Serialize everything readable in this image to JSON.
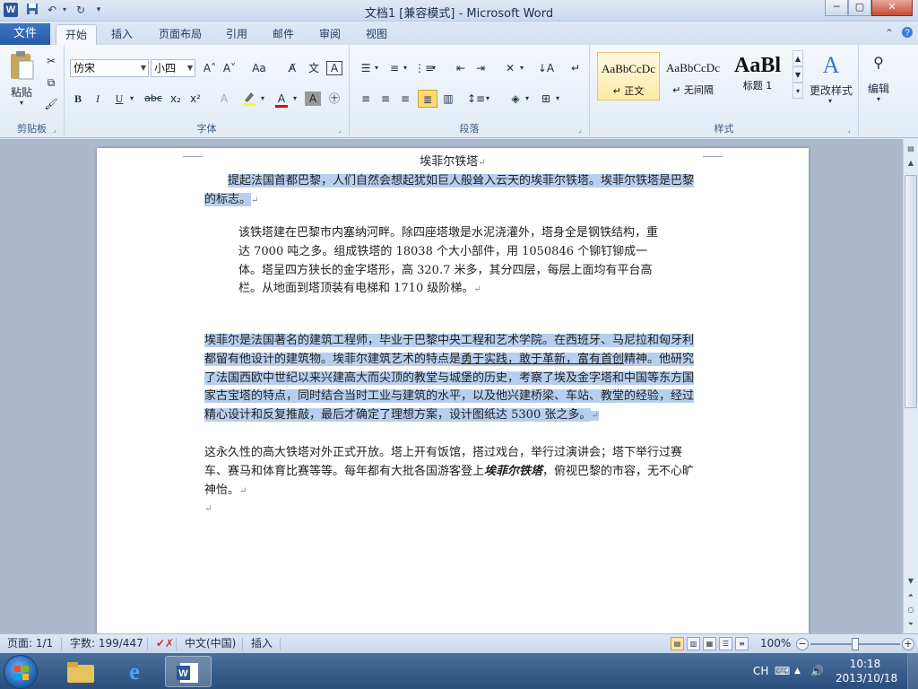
{
  "window": {
    "title": "文档1 [兼容模式] - Microsoft Word",
    "app_icon": "W",
    "minimize": "─",
    "restore": "▢",
    "close": "✕"
  },
  "quick_access": [
    "save-icon",
    "undo-icon",
    "redo-icon",
    "customize-icon"
  ],
  "tabs": {
    "file": "文件",
    "items": [
      {
        "label": "开始",
        "active": true
      },
      {
        "label": "插入",
        "active": false
      },
      {
        "label": "页面布局",
        "active": false
      },
      {
        "label": "引用",
        "active": false
      },
      {
        "label": "邮件",
        "active": false
      },
      {
        "label": "审阅",
        "active": false
      },
      {
        "label": "视图",
        "active": false
      }
    ]
  },
  "ribbon": {
    "clipboard": {
      "label": "剪贴板",
      "paste": "粘贴"
    },
    "font": {
      "label": "字体",
      "family": "仿宋",
      "size": "小四",
      "grow": "A˄",
      "shrink": "A˅",
      "change_case": "Aa",
      "bold": "B",
      "italic": "I",
      "underline": "U",
      "strike": "abc",
      "subscript": "x₂",
      "superscript": "x²",
      "font_color": "A"
    },
    "paragraph": {
      "label": "段落"
    },
    "styles": {
      "label": "样式",
      "items": [
        {
          "sample": "AaBbCcDc",
          "name": "↵ 正文",
          "selected": true
        },
        {
          "sample": "AaBbCcDc",
          "name": "↵ 无间隔",
          "selected": false
        },
        {
          "sample": "AaBl",
          "name": "标题 1",
          "selected": false
        }
      ],
      "change_styles": "更改样式"
    },
    "editing": {
      "label": "编辑"
    }
  },
  "document": {
    "title": "埃菲尔铁塔",
    "p1": "提起法国首都巴黎，人们自然会想起犹如巨人般耸入云天的埃菲尔铁塔。埃菲尔铁塔是巴黎的标志。",
    "p2": "该铁塔建在巴黎市内塞纳河畔。除四座塔墩是水泥浇灌外，塔身全是钢铁结构，重达 7000 吨之多。组成铁塔的 18038 个大小部件，用 1050846 个铆钉铆成一体。塔呈四方狭长的金字塔形，高 320.7 米多，其分四层，每层上面均有平台高栏。从地面到塔顶装有电梯和 1710 级阶梯。",
    "p3a": "埃菲尔是法国著名的建筑工程师，毕业于巴黎中央工程和艺术学院。在西班牙、马尼拉和匈牙利都留有他设计的建筑物。埃菲尔建筑艺术的特点是",
    "p3_underlined": "勇于实践，敢于革新，富有首创",
    "p3b": "精神。他研究了法国西欧中世纪以来兴建高大而尖顶的教堂与城堡的历史，考察了埃及金字塔和中国等东方国家古宝塔的特点，同时结合当时工业与建筑的水平，以及他兴建桥梁、车站、教堂的经验，经过精心设计和反复推敲，最后才确定了理想方案，设计图纸达 5300 张之多。",
    "p4a": "这永久性的高大铁塔对外正式开放。塔上开有饭馆，搭过戏台，举行过演讲会；塔下举行过赛车、赛马和体育比赛等等。每年都有大批各国游客登上",
    "p4_emph": "埃菲尔铁塔",
    "p4b": "，俯视巴黎的市容，无不心旷神怡。",
    "para_mark": "↵"
  },
  "status": {
    "page": "页面: 1/1",
    "words": "字数: 199/447",
    "language": "中文(中国)",
    "mode": "插入",
    "zoom": "100%",
    "zoom_value": 100
  },
  "taskbar": {
    "ime": "CH",
    "time": "10:18",
    "date": "2013/10/18"
  }
}
